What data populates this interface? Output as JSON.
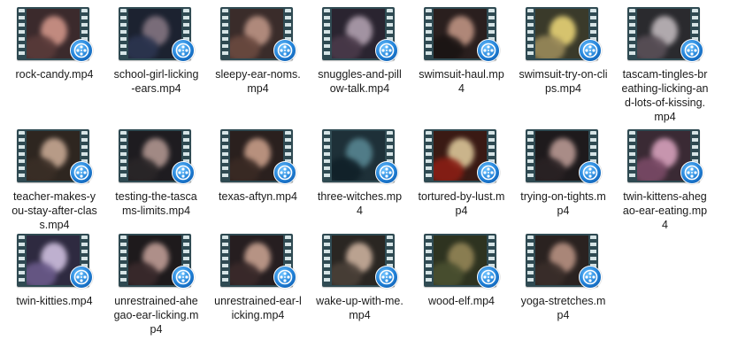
{
  "folder": {
    "items": [
      {
        "name": "rock-candy.mp4",
        "thumb": {
          "bg": "#3b2a2c",
          "c1": "#d99b8e",
          "c2": "#5a3b3a"
        }
      },
      {
        "name": "school-girl-licking-ears.mp4",
        "thumb": {
          "bg": "#1c2230",
          "c1": "#8a7a86",
          "c2": "#2c3550"
        }
      },
      {
        "name": "sleepy-ear-noms.mp4",
        "thumb": {
          "bg": "#3a2c2a",
          "c1": "#c49a8a",
          "c2": "#6b4a40"
        }
      },
      {
        "name": "snuggles-and-pillow-talk.mp4",
        "thumb": {
          "bg": "#2a2430",
          "c1": "#b8a7b6",
          "c2": "#4a3a4a"
        }
      },
      {
        "name": "swimsuit-haul.mp4",
        "thumb": {
          "bg": "#2a1f1e",
          "c1": "#c79a88",
          "c2": "#1a1413"
        }
      },
      {
        "name": "swimsuit-try-on-clips.mp4",
        "thumb": {
          "bg": "#3a3a2a",
          "c1": "#f2dc7a",
          "c2": "#9a8a5a"
        }
      },
      {
        "name": "tascam-tingles-breathing-licking-and-lots-of-kissing.mp4",
        "thumb": {
          "bg": "#2a2a2e",
          "c1": "#c8c0c4",
          "c2": "#5a5058"
        }
      },
      {
        "name": "teacher-makes-you-stay-after-class.mp4",
        "thumb": {
          "bg": "#2e2620",
          "c1": "#d0b09a",
          "c2": "#3a2e26"
        }
      },
      {
        "name": "testing-the-tascams-limits.mp4",
        "thumb": {
          "bg": "#1e1c20",
          "c1": "#b89c96",
          "c2": "#2a2628"
        }
      },
      {
        "name": "texas-aftyn.mp4",
        "thumb": {
          "bg": "#2a201e",
          "c1": "#d0a48e",
          "c2": "#3a2a24"
        }
      },
      {
        "name": "three-witches.mp4",
        "thumb": {
          "bg": "#1e3038",
          "c1": "#5a8a96",
          "c2": "#102028"
        }
      },
      {
        "name": "tortured-by-lust.mp4",
        "thumb": {
          "bg": "#3a1a14",
          "c1": "#e4d0a0",
          "c2": "#8a1e14"
        }
      },
      {
        "name": "trying-on-tights.mp4",
        "thumb": {
          "bg": "#1e1a1c",
          "c1": "#c2a09a",
          "c2": "#2a2224"
        }
      },
      {
        "name": "twin-kittens-ahegao-ear-eating.mp4",
        "thumb": {
          "bg": "#3a2a34",
          "c1": "#e0a8c4",
          "c2": "#7a4a66"
        }
      },
      {
        "name": "twin-kitties.mp4",
        "thumb": {
          "bg": "#2e2a40",
          "c1": "#d8c8e8",
          "c2": "#6a5a8a"
        }
      },
      {
        "name": "unrestrained-ahegao-ear-licking.mp4",
        "thumb": {
          "bg": "#1e1a1c",
          "c1": "#c8a49c",
          "c2": "#3a2a2c"
        }
      },
      {
        "name": "unrestrained-ear-licking.mp4",
        "thumb": {
          "bg": "#261e20",
          "c1": "#d0a896",
          "c2": "#3a2a2a"
        }
      },
      {
        "name": "wake-up-with-me.mp4",
        "thumb": {
          "bg": "#2a2622",
          "c1": "#d4b8a4",
          "c2": "#4a4038"
        }
      },
      {
        "name": "wood-elf.mp4",
        "thumb": {
          "bg": "#2e3320",
          "c1": "#9a8a5a",
          "c2": "#4a5030"
        }
      },
      {
        "name": "yoga-stretches.mp4",
        "thumb": {
          "bg": "#2a2220",
          "c1": "#c09888",
          "c2": "#3a2e2a"
        }
      }
    ],
    "badge_color": "#1f7fd6",
    "frame_color": "#2f4a52"
  }
}
